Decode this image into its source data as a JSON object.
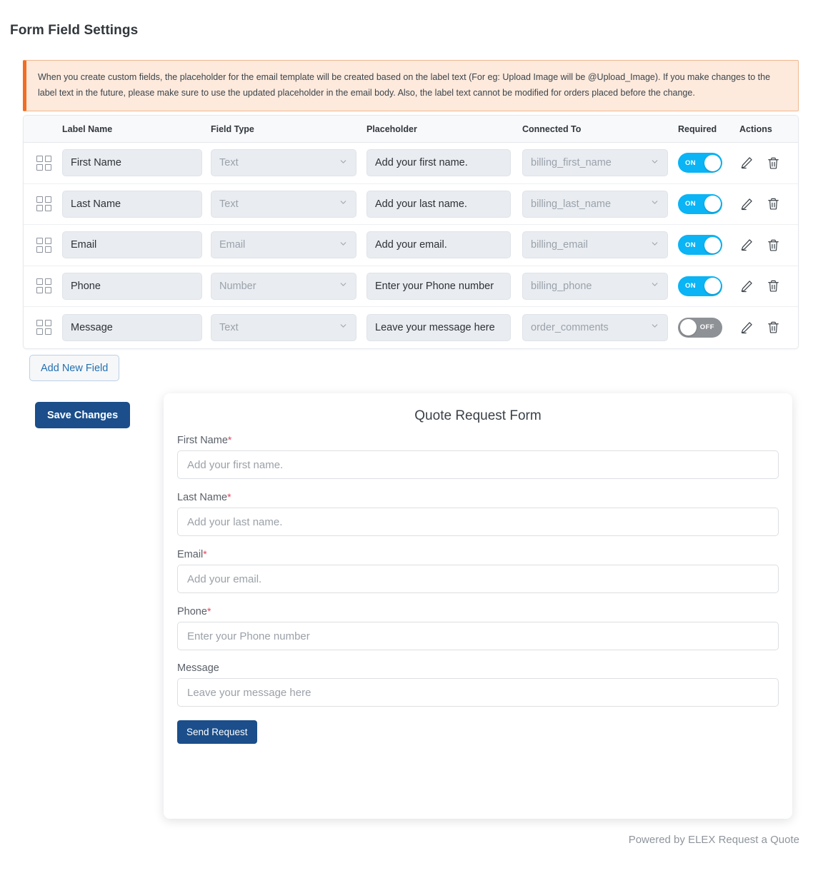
{
  "page": {
    "title": "Form Field Settings"
  },
  "notice": {
    "text": "When you create custom fields, the placeholder for the email template will be created based on the label text (For eg: Upload Image will be @Upload_Image). If you make changes to the label text in the future, please make sure to use the updated placeholder in the email body. Also, the label text cannot be modified for orders placed before the change.",
    "accent_color": "#f26d21",
    "background_color": "#fdeadd"
  },
  "table": {
    "headers": {
      "label_name": "Label Name",
      "field_type": "Field Type",
      "placeholder": "Placeholder",
      "connected_to": "Connected To",
      "required": "Required",
      "actions": "Actions"
    },
    "rows": [
      {
        "drag_handle_icon": "grid-handle-icon",
        "label_name": "First Name",
        "field_type": "Text",
        "placeholder": "Add your first name.",
        "connected_to": "billing_first_name",
        "required": true,
        "required_label": "ON",
        "edit_icon": "pencil-icon",
        "delete_icon": "trash-icon"
      },
      {
        "drag_handle_icon": "grid-handle-icon",
        "label_name": "Last Name",
        "field_type": "Text",
        "placeholder": "Add your last name.",
        "connected_to": "billing_last_name",
        "required": true,
        "required_label": "ON",
        "edit_icon": "pencil-icon",
        "delete_icon": "trash-icon"
      },
      {
        "drag_handle_icon": "grid-handle-icon",
        "label_name": "Email",
        "field_type": "Email",
        "placeholder": "Add your email.",
        "connected_to": "billing_email",
        "required": true,
        "required_label": "ON",
        "edit_icon": "pencil-icon",
        "delete_icon": "trash-icon"
      },
      {
        "drag_handle_icon": "grid-handle-icon",
        "label_name": "Phone",
        "field_type": "Number",
        "placeholder": "Enter your Phone number",
        "connected_to": "billing_phone",
        "required": true,
        "required_label": "ON",
        "edit_icon": "pencil-icon",
        "delete_icon": "trash-icon"
      },
      {
        "drag_handle_icon": "grid-handle-icon",
        "label_name": "Message",
        "field_type": "Text",
        "placeholder": "Leave your message here",
        "connected_to": "order_comments",
        "required": false,
        "required_label": "OFF",
        "edit_icon": "pencil-icon",
        "delete_icon": "trash-icon"
      }
    ]
  },
  "buttons": {
    "add_new_field": "Add New Field",
    "save_changes": "Save Changes",
    "save_bg_color": "#1b4e8a"
  },
  "preview": {
    "title": "Quote Request Form",
    "required_marker": "*",
    "fields": [
      {
        "label": "First Name",
        "placeholder": "Add your first name.",
        "required": true
      },
      {
        "label": "Last Name",
        "placeholder": "Add your last name.",
        "required": true
      },
      {
        "label": "Email",
        "placeholder": "Add your email.",
        "required": true
      },
      {
        "label": "Phone",
        "placeholder": "Enter your Phone number",
        "required": true
      },
      {
        "label": "Message",
        "placeholder": "Leave your message here",
        "required": false
      }
    ],
    "submit_label": "Send Request"
  },
  "footer": {
    "text": "Powered by ELEX Request a Quote"
  }
}
